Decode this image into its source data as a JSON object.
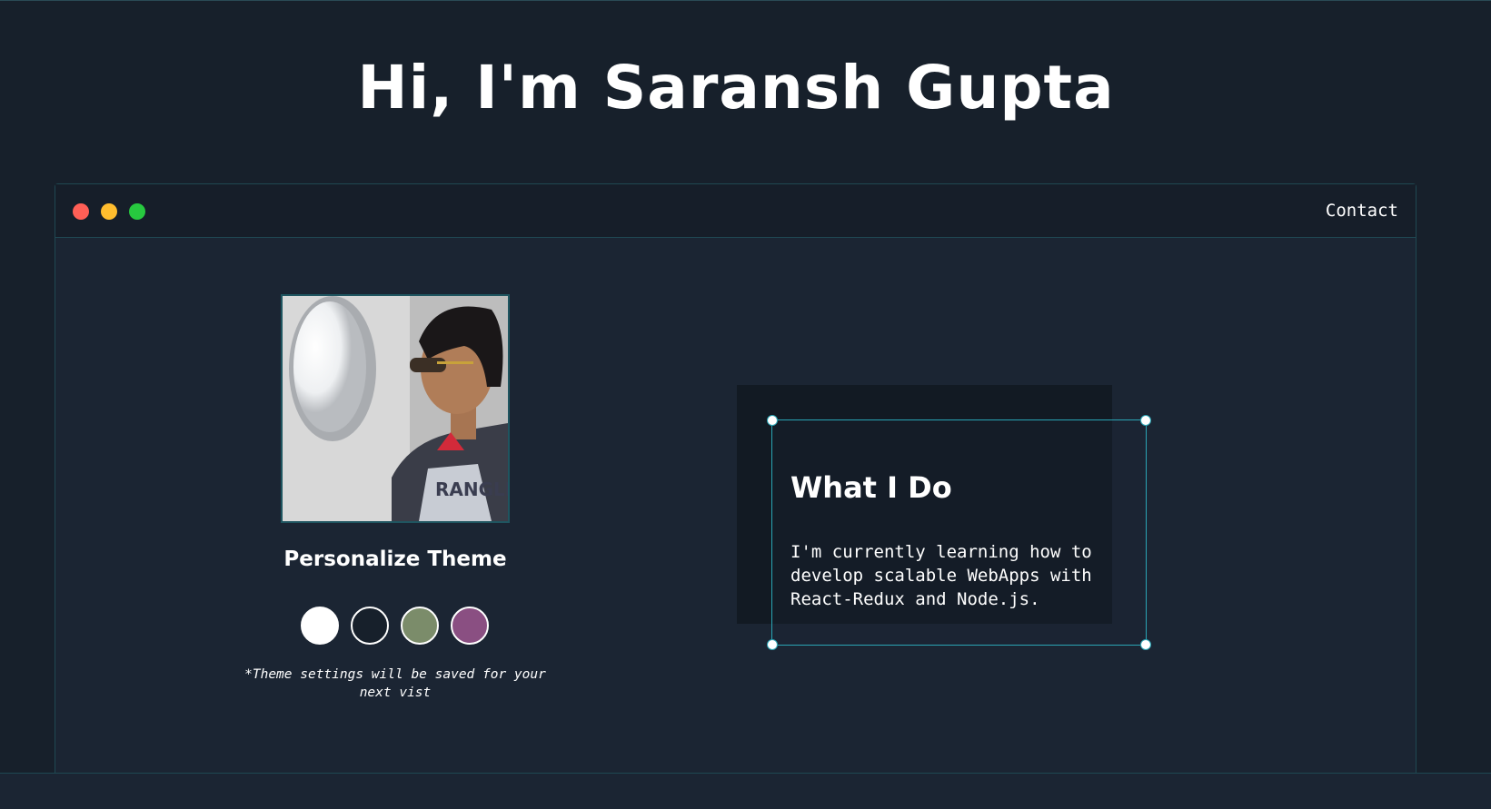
{
  "hero": {
    "title": "Hi, I'm Saransh Gupta"
  },
  "window": {
    "controls": [
      "close",
      "minimize",
      "maximize"
    ],
    "control_colors": {
      "close": "#ff5f56",
      "minimize": "#ffbd2e",
      "maximize": "#27c93f"
    },
    "nav": {
      "contact_label": "Contact"
    }
  },
  "profile": {
    "photo_icon": "profile-photo"
  },
  "theme": {
    "title": "Personalize Theme",
    "swatches": [
      {
        "name": "light",
        "color": "#ffffff"
      },
      {
        "name": "dark",
        "color": "#17202b"
      },
      {
        "name": "green",
        "color": "#7b8c6a"
      },
      {
        "name": "purple",
        "color": "#8a4f82"
      }
    ],
    "note": "*Theme settings will be saved for your next vist"
  },
  "what_i_do": {
    "title": "What I Do",
    "text": "I'm currently learning how to develop scalable WebApps with React-Redux and Node.js."
  },
  "colors": {
    "background": "#17202b",
    "panel": "#1b2533",
    "accent": "#2aa5b5"
  }
}
